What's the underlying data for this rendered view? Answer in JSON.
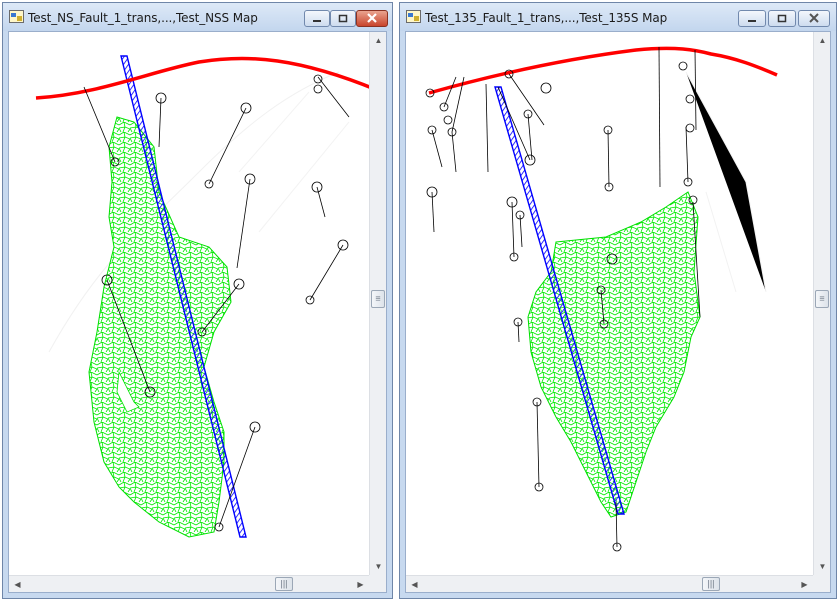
{
  "left_window": {
    "title": "Test_NS_Fault_1_trans,...,Test_NSS Map",
    "icon": "map-window-icon",
    "controls": {
      "minimize_icon": "minimize-icon",
      "maximize_icon": "maximize-icon",
      "close_icon": "close-icon"
    },
    "colors": {
      "surface_outline": "#ff0000",
      "fault_plane": "#0000ff",
      "grid_mesh": "#00ee00",
      "wells": "#000000"
    }
  },
  "right_window": {
    "title": "Test_135_Fault_1_trans,...,Test_135S Map",
    "icon": "map-window-icon",
    "controls": {
      "minimize_icon": "minimize-icon",
      "maximize_icon": "maximize-icon",
      "close_icon": "close-icon"
    },
    "colors": {
      "surface_outline": "#ff0000",
      "fault_plane": "#0000ff",
      "grid_mesh": "#00ee00",
      "wells": "#000000"
    }
  }
}
